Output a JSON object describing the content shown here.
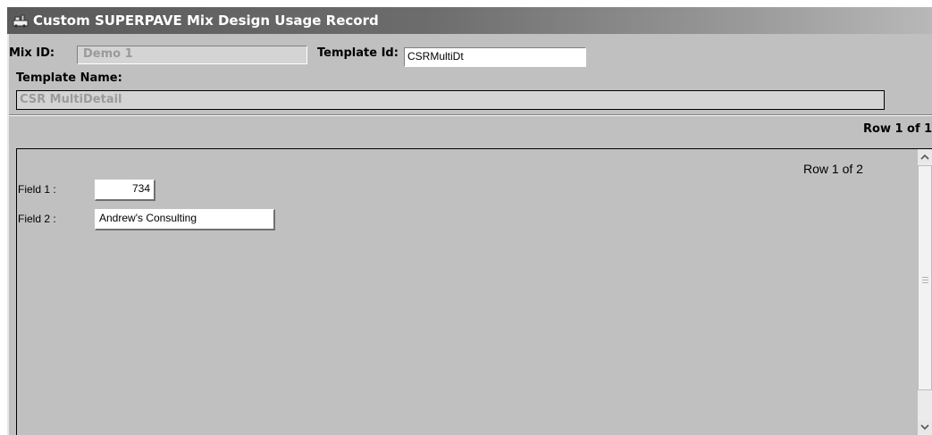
{
  "window": {
    "title": "Custom SUPERPAVE Mix Design Usage Record"
  },
  "header": {
    "mix_id_label": "Mix ID:",
    "mix_id_value": "Demo 1",
    "template_id_label": "Template Id:",
    "template_id_value": "CSRMultiDt",
    "template_name_label": "Template Name:",
    "template_name_value": "CSR MultiDetail",
    "row_indicator": "Row 1 of 1"
  },
  "detail": {
    "row_indicator": "Row 1 of 2",
    "fields": [
      {
        "label": "Field 1 :",
        "value": "734"
      },
      {
        "label": "Field 2 :",
        "value": "Andrew's Consulting"
      }
    ]
  },
  "icons": {
    "app": "app-icon",
    "scroll_up": "chevron-up-icon",
    "scroll_down": "chevron-down-icon"
  },
  "colors": {
    "background": "#c0c0c0",
    "titlebar_start": "#5a5a5a",
    "titlebar_end": "#b8b8b8",
    "disabled_text": "#9a9a9a"
  }
}
